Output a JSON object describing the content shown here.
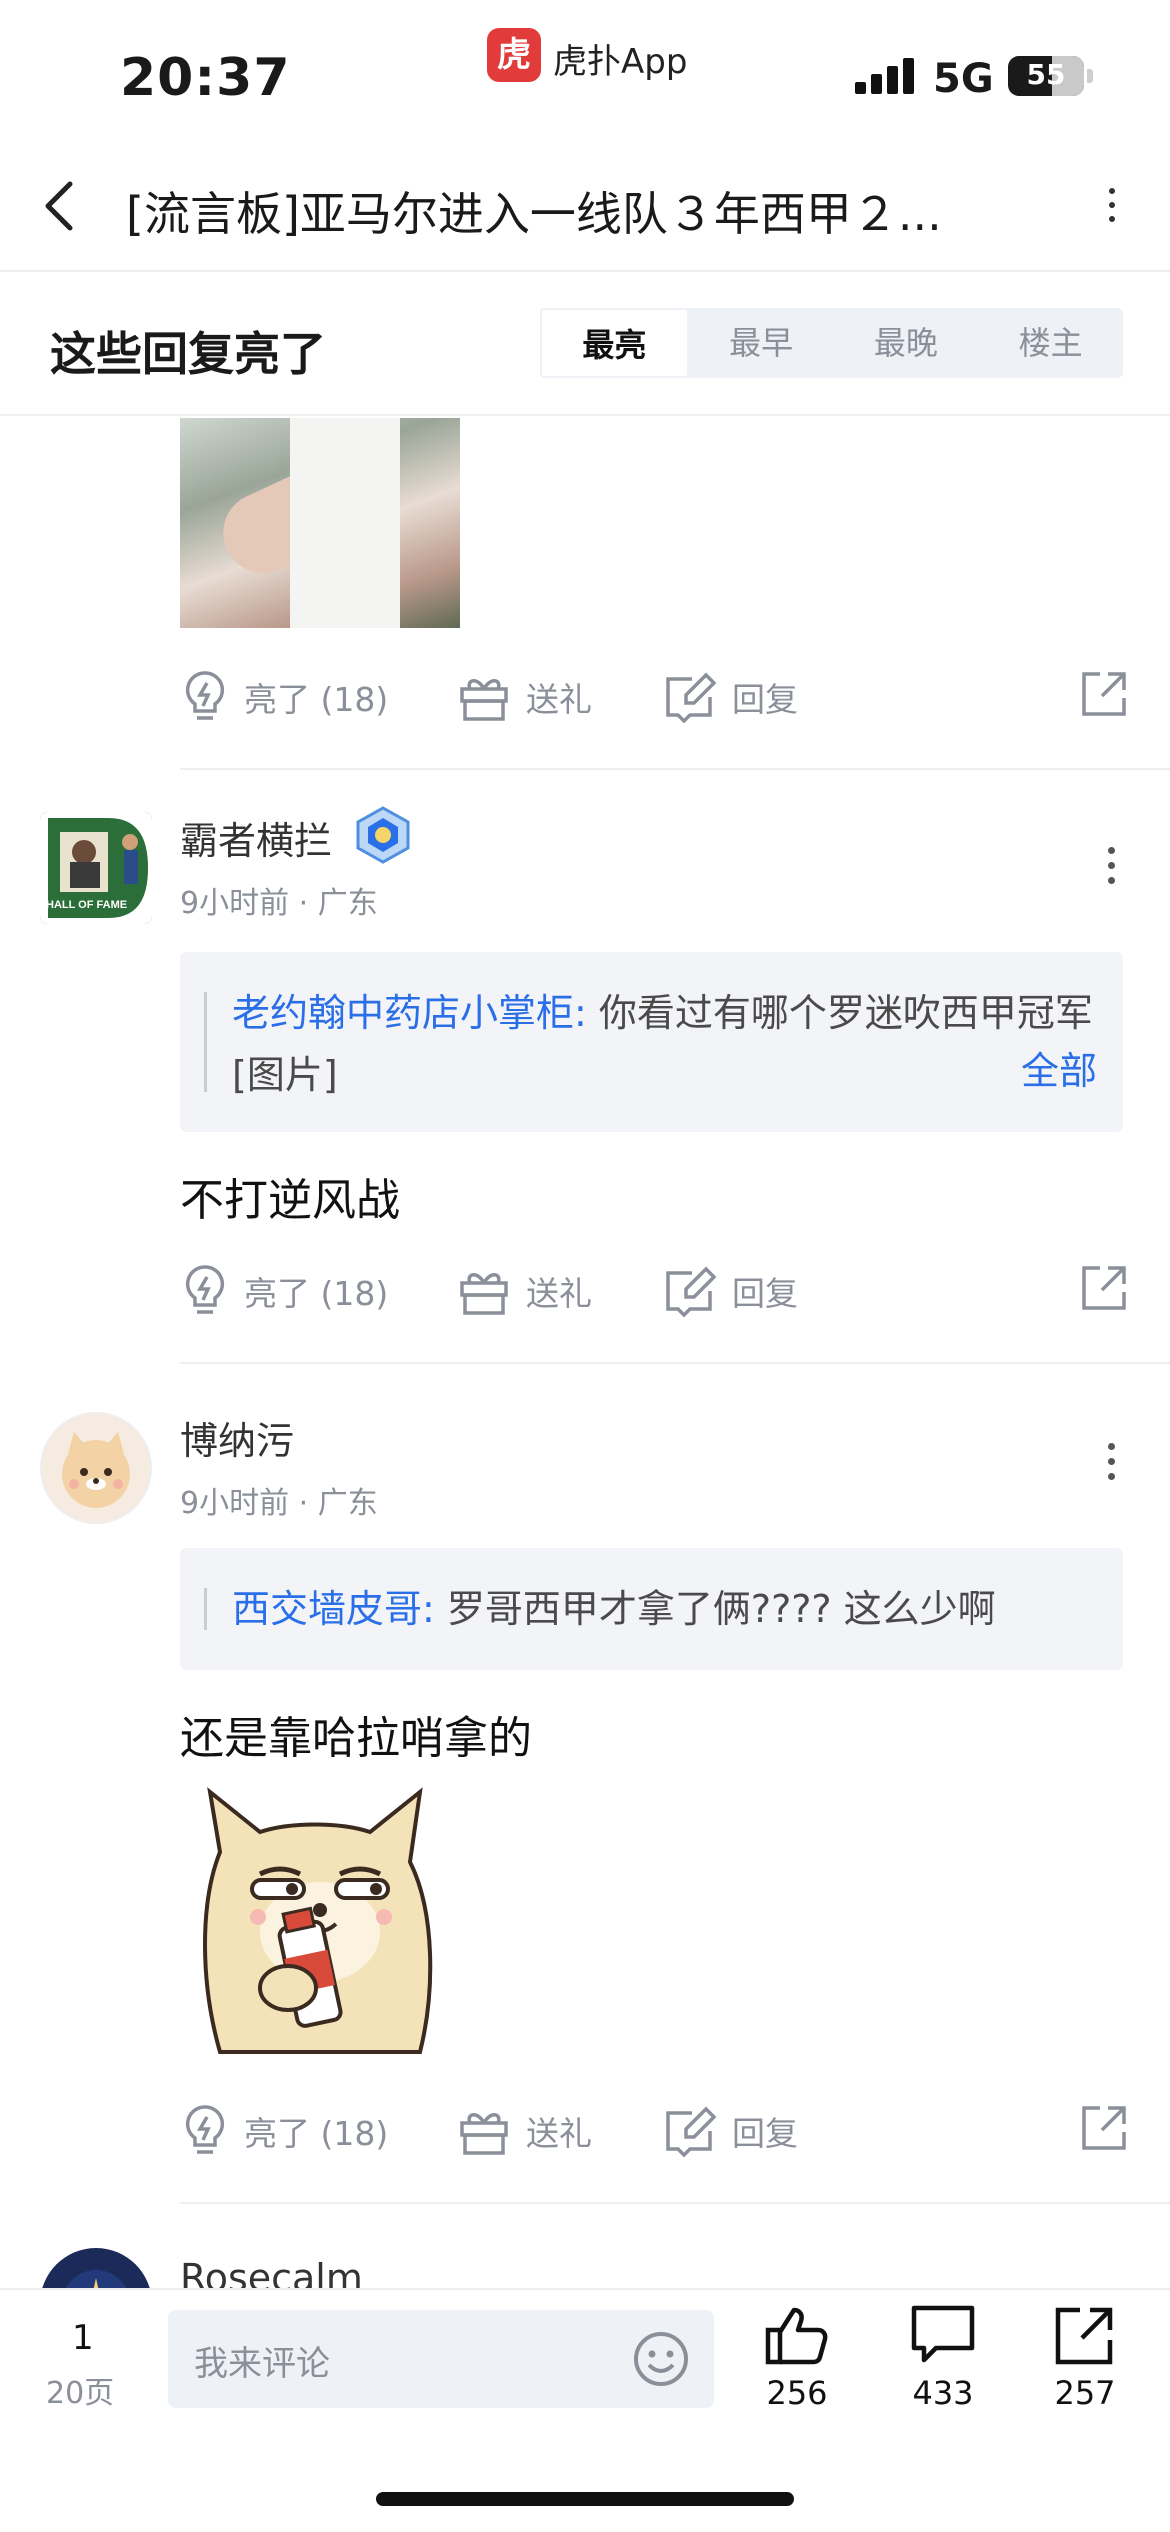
{
  "status_bar": {
    "time": "20:37",
    "app_badge": "虎",
    "app_name": "虎扑App",
    "network": "5G",
    "battery": "55",
    "battery_level": 0.55
  },
  "nav": {
    "title": "[流言板]亚马尔进入一线队３年西甲２..."
  },
  "highlight": {
    "label": "这些回复亮了",
    "tabs": [
      "最亮",
      "最早",
      "最晚",
      "楼主"
    ],
    "active_tab": "最亮"
  },
  "actions": {
    "light_label": "亮了 (18)",
    "gift_label": "送礼",
    "reply_label": "回复"
  },
  "posts": [
    {
      "username": "霸者横拦",
      "meta": "9小时前 · 广东",
      "avatar_text": "HALL OF FAME",
      "quote_name": "老约翰中药店小掌柜:",
      "quote_text": "你看过有哪个罗迷吹西甲冠军[图片]",
      "quote_more": "全部",
      "body": "不打逆风战"
    },
    {
      "username": "博纳污",
      "meta": "9小时前 · 广东",
      "quote_name": "西交墙皮哥:",
      "quote_text": "罗哥西甲才拿了俩????  这么少啊",
      "body": "还是靠哈拉哨拿的"
    },
    {
      "username": "Rosecalm"
    }
  ],
  "bottom_bar": {
    "page_current": "1",
    "page_total": "20页",
    "comment_placeholder": "我来评论",
    "likes": "256",
    "comments": "433",
    "shares": "257"
  }
}
